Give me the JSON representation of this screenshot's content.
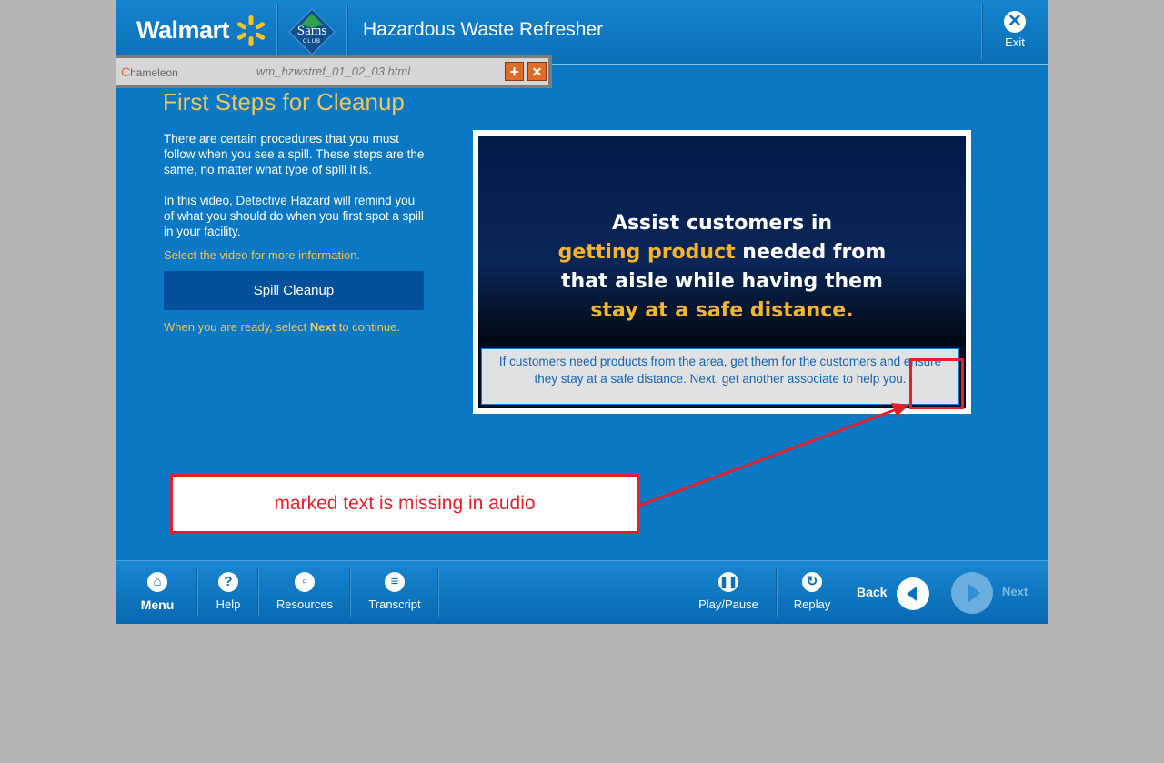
{
  "header": {
    "brand": "Walmart",
    "sams_logo": "Sams",
    "sams_sub": "CLUB",
    "course_title": "Hazardous Waste Refresher",
    "exit_label": "Exit"
  },
  "chameleon": {
    "logo": "hameleon",
    "logo_initial": "C",
    "filename": "wm_hzwstref_01_02_03.html",
    "add_label": "+",
    "close_label": "✕"
  },
  "content": {
    "title": "First Steps for Cleanup",
    "para1": "There are certain procedures that you must follow when you see a spill.  These steps are the same, no matter what type of spill it is.",
    "para2": "In this video, Detective Hazard will remind you of what you should do when you first spot a spill in your facility.",
    "select_hint": "Select the video for more information.",
    "video_button": "Spill Cleanup",
    "continue_pre": "When you are ready, select ",
    "continue_next": "Next",
    "continue_post": " to continue."
  },
  "video": {
    "line1": "Assist customers in",
    "line2_gold": "getting product",
    "line2_white": " needed from",
    "line3": "that aisle while having them",
    "line4_gold": "stay at a safe distance.",
    "caption": "If customers need products from the area, get them for the customers and ensure they stay at a safe distance.  Next, get another associate to help you."
  },
  "annotation": {
    "text": "marked text is missing in audio"
  },
  "footer": {
    "menu": "Menu",
    "help": "Help",
    "resources": "Resources",
    "transcript": "Transcript",
    "play_pause": "Play/Pause",
    "replay": "Replay",
    "back": "Back",
    "next": "Next"
  },
  "colors": {
    "app_bg": "#0a78c2",
    "accent_gold": "#f2c55c",
    "annotation_red": "#e4212a",
    "video_button_bg": "#034f99"
  }
}
